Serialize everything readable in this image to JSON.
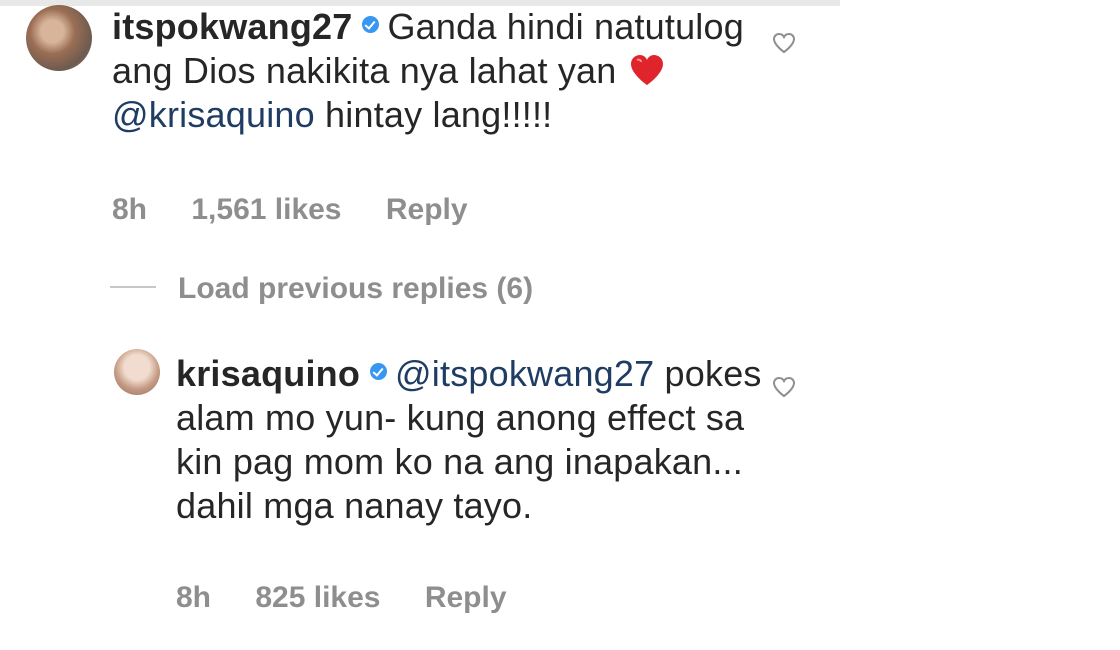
{
  "comment": {
    "username": "itspokwang27",
    "text_part1": "Ganda hindi natutulog ang Dios nakikita nya lahat yan",
    "mention": "@krisaquino",
    "text_part2": "hintay lang!!!!!",
    "time": "8h",
    "likes": "1,561 likes",
    "reply_label": "Reply"
  },
  "load_previous_label": "Load previous replies (6)",
  "reply": {
    "username": "krisaquino",
    "mention": "@itspokwang27",
    "text": "pokes alam mo yun- kung anong effect sa kin pag mom ko na ang inapakan... dahil mga nanay tayo.",
    "time": "8h",
    "likes": "825 likes",
    "reply_label": "Reply"
  },
  "colors": {
    "verified": "#3897f0",
    "mention": "#1f3d63",
    "meta": "#8e8e8e",
    "heart": "#e0242c"
  },
  "icons": {
    "verified": "verified-badge-icon",
    "like": "heart-outline-icon",
    "emoji": "red-heart-emoji"
  }
}
